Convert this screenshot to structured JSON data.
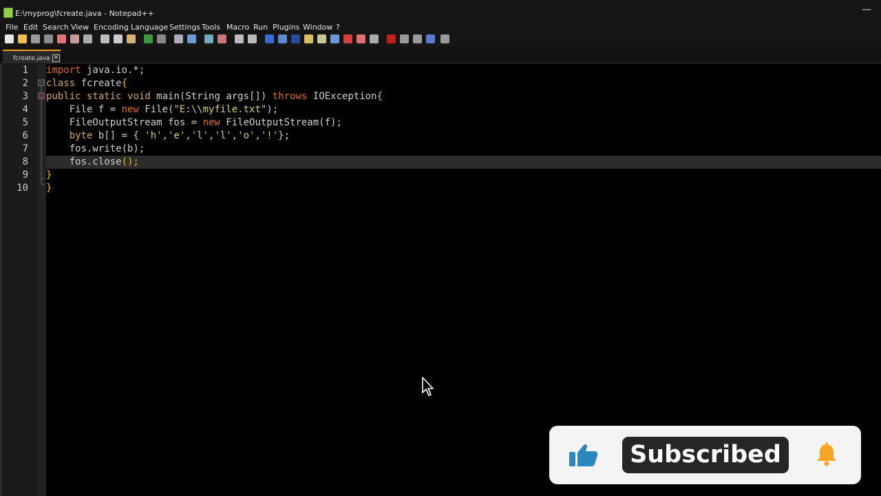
{
  "window": {
    "title": "E:\\myprog\\fcreate.java - Notepad++",
    "minimize_glyph": "—"
  },
  "menu": [
    "File",
    "Edit",
    "Search",
    "View",
    "Encoding",
    "Language",
    "Settings",
    "Tools",
    "Macro",
    "Run",
    "Plugins",
    "Window",
    "?"
  ],
  "tab": {
    "label": "fcreate.java",
    "close_glyph": "✕"
  },
  "line_numbers": [
    "1",
    "2",
    "3",
    "4",
    "5",
    "6",
    "7",
    "8",
    "9",
    "10"
  ],
  "code": {
    "l1": {
      "kw": "import",
      "rest": " java.io.*;"
    },
    "l2": {
      "kw": "class",
      "name": " fcreate",
      "brace": "{"
    },
    "l3": {
      "kw1": "public",
      "kw2": " static",
      "kw3": " void",
      "mid": " main(String args[]) ",
      "kw4": "throws",
      "tail": " IOException",
      "brace": "{"
    },
    "l4": {
      "pre": "    File f = ",
      "kw": "new",
      "mid": " File(",
      "str": "\"E:\\\\myfile.txt\"",
      "tail": ");"
    },
    "l5": {
      "pre": "    FileOutputStream fos = ",
      "kw": "new",
      "tail": " FileOutputStream(f);"
    },
    "l6": {
      "indent": "    ",
      "kw": "byte",
      "mid": " b[] = { ",
      "str": "'h','e','l','l','o','!'",
      "tail": "};"
    },
    "l7": {
      "text": "    fos.write(b);"
    },
    "l8": {
      "text": "    fos.close",
      "paren": "();"
    },
    "l9": {
      "brace": "}"
    },
    "l10": {
      "brace": "}"
    }
  },
  "overlay": {
    "subscribe_label": "Subscribed"
  },
  "colors": {
    "keyword": "#e06c16",
    "string": "#d9d26c",
    "tab_accent": "#f29d1d",
    "bell": "#f5a623",
    "like": "#2e86c1"
  }
}
